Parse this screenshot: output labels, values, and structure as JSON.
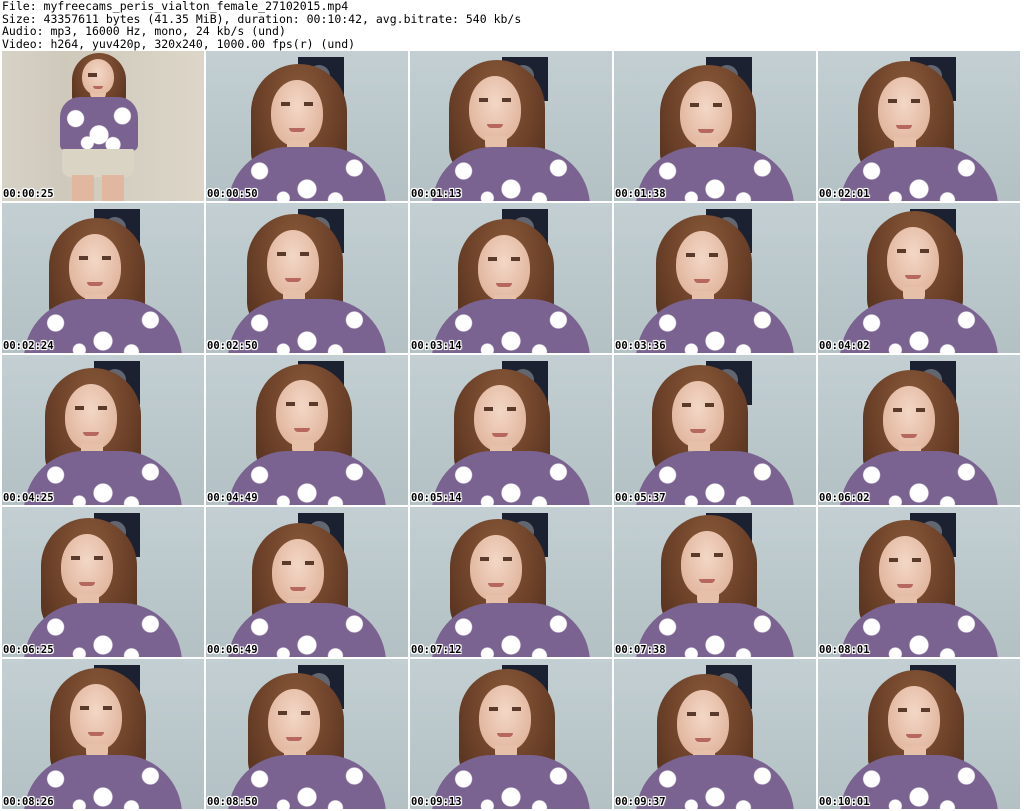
{
  "header": {
    "file": "File: myfreecams_peris_vialton_female_27102015.mp4",
    "size": "Size: 43357611 bytes (41.35 MiB), duration: 00:10:42, avg.bitrate: 540 kb/s",
    "audio": "Audio: mp3, 16000 Hz, mono, 24 kb/s (und)",
    "video": "Video: h264, yuv420p, 320x240, 1000.00 fps(r) (und)"
  },
  "thumbnails": [
    {
      "timestamp": "00:00:25"
    },
    {
      "timestamp": "00:00:50"
    },
    {
      "timestamp": "00:01:13"
    },
    {
      "timestamp": "00:01:38"
    },
    {
      "timestamp": "00:02:01"
    },
    {
      "timestamp": "00:02:24"
    },
    {
      "timestamp": "00:02:50"
    },
    {
      "timestamp": "00:03:14"
    },
    {
      "timestamp": "00:03:36"
    },
    {
      "timestamp": "00:04:02"
    },
    {
      "timestamp": "00:04:25"
    },
    {
      "timestamp": "00:04:49"
    },
    {
      "timestamp": "00:05:14"
    },
    {
      "timestamp": "00:05:37"
    },
    {
      "timestamp": "00:06:02"
    },
    {
      "timestamp": "00:06:25"
    },
    {
      "timestamp": "00:06:49"
    },
    {
      "timestamp": "00:07:12"
    },
    {
      "timestamp": "00:07:38"
    },
    {
      "timestamp": "00:08:01"
    },
    {
      "timestamp": "00:08:26"
    },
    {
      "timestamp": "00:08:50"
    },
    {
      "timestamp": "00:09:13"
    },
    {
      "timestamp": "00:09:37"
    },
    {
      "timestamp": "00:10:01"
    }
  ]
}
